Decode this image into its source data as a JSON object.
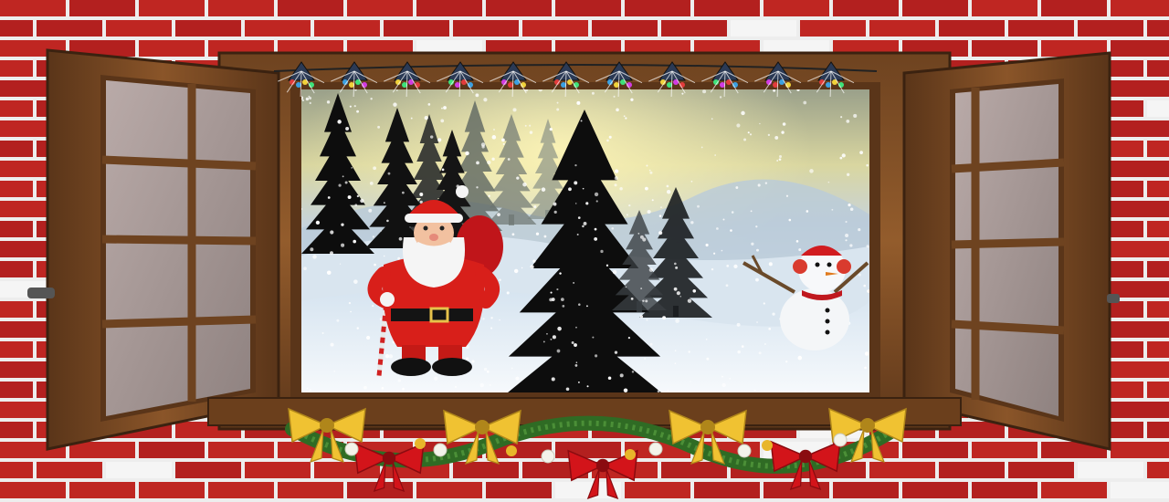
{
  "scene": {
    "description_free": true,
    "colors": {
      "brick": "#b3201f",
      "brick_light": "#c92a25",
      "mortar": "#ededed",
      "wood_dark": "#4a2e16",
      "wood": "#7a4a22",
      "wood_light": "#9a6632",
      "snow": "#eef4fa",
      "sky_yellow": "#e8e2a6",
      "tree": "#0d0d0d",
      "santa_red": "#d81f1a",
      "bow_gold": "#f0c232",
      "bow_red": "#d3141a",
      "garland": "#2f6b24"
    },
    "elements": [
      "brick-wall",
      "window-frame",
      "left-shutter",
      "right-shutter",
      "winter-landscape",
      "pine-trees",
      "santa-claus",
      "snowman",
      "string-lights",
      "garland-with-bows"
    ]
  }
}
